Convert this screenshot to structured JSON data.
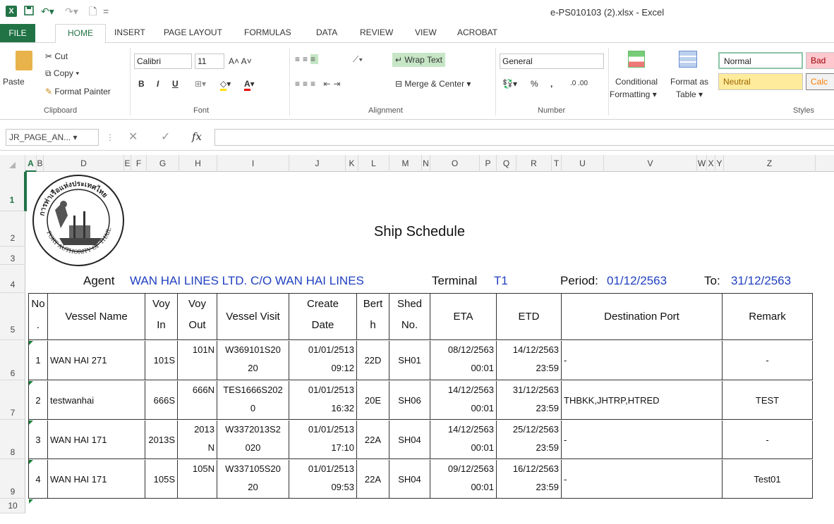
{
  "window": {
    "title": "e-PS010103 (2).xlsx - Excel"
  },
  "tabs": [
    "FILE",
    "HOME",
    "INSERT",
    "PAGE LAYOUT",
    "FORMULAS",
    "DATA",
    "REVIEW",
    "VIEW",
    "ACROBAT"
  ],
  "ribbon": {
    "clipboard": {
      "paste": "Paste",
      "cut": "Cut",
      "copy": "Copy",
      "format_painter": "Format Painter",
      "label": "Clipboard"
    },
    "font": {
      "name": "Calibri",
      "size": "11",
      "label": "Font",
      "bold": "B",
      "italic": "I",
      "underline": "U"
    },
    "alignment": {
      "wrap_text": "Wrap Text",
      "merge_center": "Merge & Center",
      "label": "Alignment"
    },
    "number": {
      "format": "General",
      "percent": "%",
      "comma": ",",
      "label": "Number"
    },
    "styles": {
      "conditional": "Conditional",
      "formatting": "Formatting",
      "format_as": "Format as",
      "table": "Table",
      "normal": "Normal",
      "bad": "Bad",
      "neutral": "Neutral",
      "calc": "Calc",
      "label": "Styles"
    }
  },
  "formula_bar": {
    "name_box": "JR_PAGE_AN...",
    "fx": "fx",
    "value": ""
  },
  "columns": [
    "A",
    "B",
    "D",
    "E",
    "F",
    "G",
    "H",
    "I",
    "J",
    "K",
    "L",
    "M",
    "N",
    "O",
    "P",
    "Q",
    "R",
    "T",
    "U",
    "V",
    "W",
    "X",
    "Y",
    "Z"
  ],
  "rows": [
    "1",
    "2",
    "3",
    "4",
    "5",
    "6",
    "7",
    "8",
    "9",
    "10"
  ],
  "sheet": {
    "title": "Ship Schedule",
    "agent_label": "Agent",
    "agent_value": "WAN HAI LINES LTD. C/O WAN HAI LINES",
    "terminal_label": "Terminal",
    "terminal_value": "T1",
    "period_label": "Period:",
    "period_value": "01/12/2563",
    "to_label": "To:",
    "to_value": "31/12/2563",
    "logo_text_top": "การท่าเรือแห่งประเทศไทย",
    "logo_text_bottom": "PORT AUTHORITY OF THAILAND"
  },
  "table": {
    "headers": {
      "no": [
        "No",
        "."
      ],
      "vessel_name": "Vessel Name",
      "voy_in": [
        "Voy",
        "In"
      ],
      "voy_out": [
        "Voy",
        "Out"
      ],
      "vessel_visit": "Vessel Visit",
      "create_date": [
        "Create",
        "Date"
      ],
      "berth": [
        "Bert",
        "h"
      ],
      "shed": [
        "Shed",
        "No."
      ],
      "eta": "ETA",
      "etd": "ETD",
      "destination": "Destination Port",
      "remark": "Remark"
    },
    "rows": [
      {
        "no": "1",
        "vessel": "WAN HAI 271",
        "voy_in": "101S",
        "voy_out": [
          "101N",
          ""
        ],
        "visit": [
          "W369101S20",
          "20"
        ],
        "create": [
          "01/01/2513",
          "09:12"
        ],
        "berth": "22D",
        "shed": "SH01",
        "eta": [
          "08/12/2563",
          "00:01"
        ],
        "etd": [
          "14/12/2563",
          "23:59"
        ],
        "dest": "-",
        "remark": "-"
      },
      {
        "no": "2",
        "vessel": "testwanhai",
        "voy_in": "666S",
        "voy_out": [
          "666N",
          ""
        ],
        "visit": [
          "TES1666S202",
          "0"
        ],
        "create": [
          "01/01/2513",
          "16:32"
        ],
        "berth": "20E",
        "shed": "SH06",
        "eta": [
          "14/12/2563",
          "00:01"
        ],
        "etd": [
          "31/12/2563",
          "23:59"
        ],
        "dest": "THBKK,JHTRP,HTRED",
        "remark": "TEST"
      },
      {
        "no": "3",
        "vessel": "WAN HAI 171",
        "voy_in": "2013S",
        "voy_out": [
          "2013",
          "N"
        ],
        "visit": [
          "W3372013S2",
          "020"
        ],
        "create": [
          "01/01/2513",
          "17:10"
        ],
        "berth": "22A",
        "shed": "SH04",
        "eta": [
          "14/12/2563",
          "00:01"
        ],
        "etd": [
          "25/12/2563",
          "23:59"
        ],
        "dest": "-",
        "remark": "-"
      },
      {
        "no": "4",
        "vessel": "WAN HAI 171",
        "voy_in": "105S",
        "voy_out": [
          "105N",
          ""
        ],
        "visit": [
          "W337105S20",
          "20"
        ],
        "create": [
          "01/01/2513",
          "09:53"
        ],
        "berth": "22A",
        "shed": "SH04",
        "eta": [
          "09/12/2563",
          "00:01"
        ],
        "etd": [
          "16/12/2563",
          "23:59"
        ],
        "dest": "-",
        "remark": "Test01"
      }
    ]
  }
}
